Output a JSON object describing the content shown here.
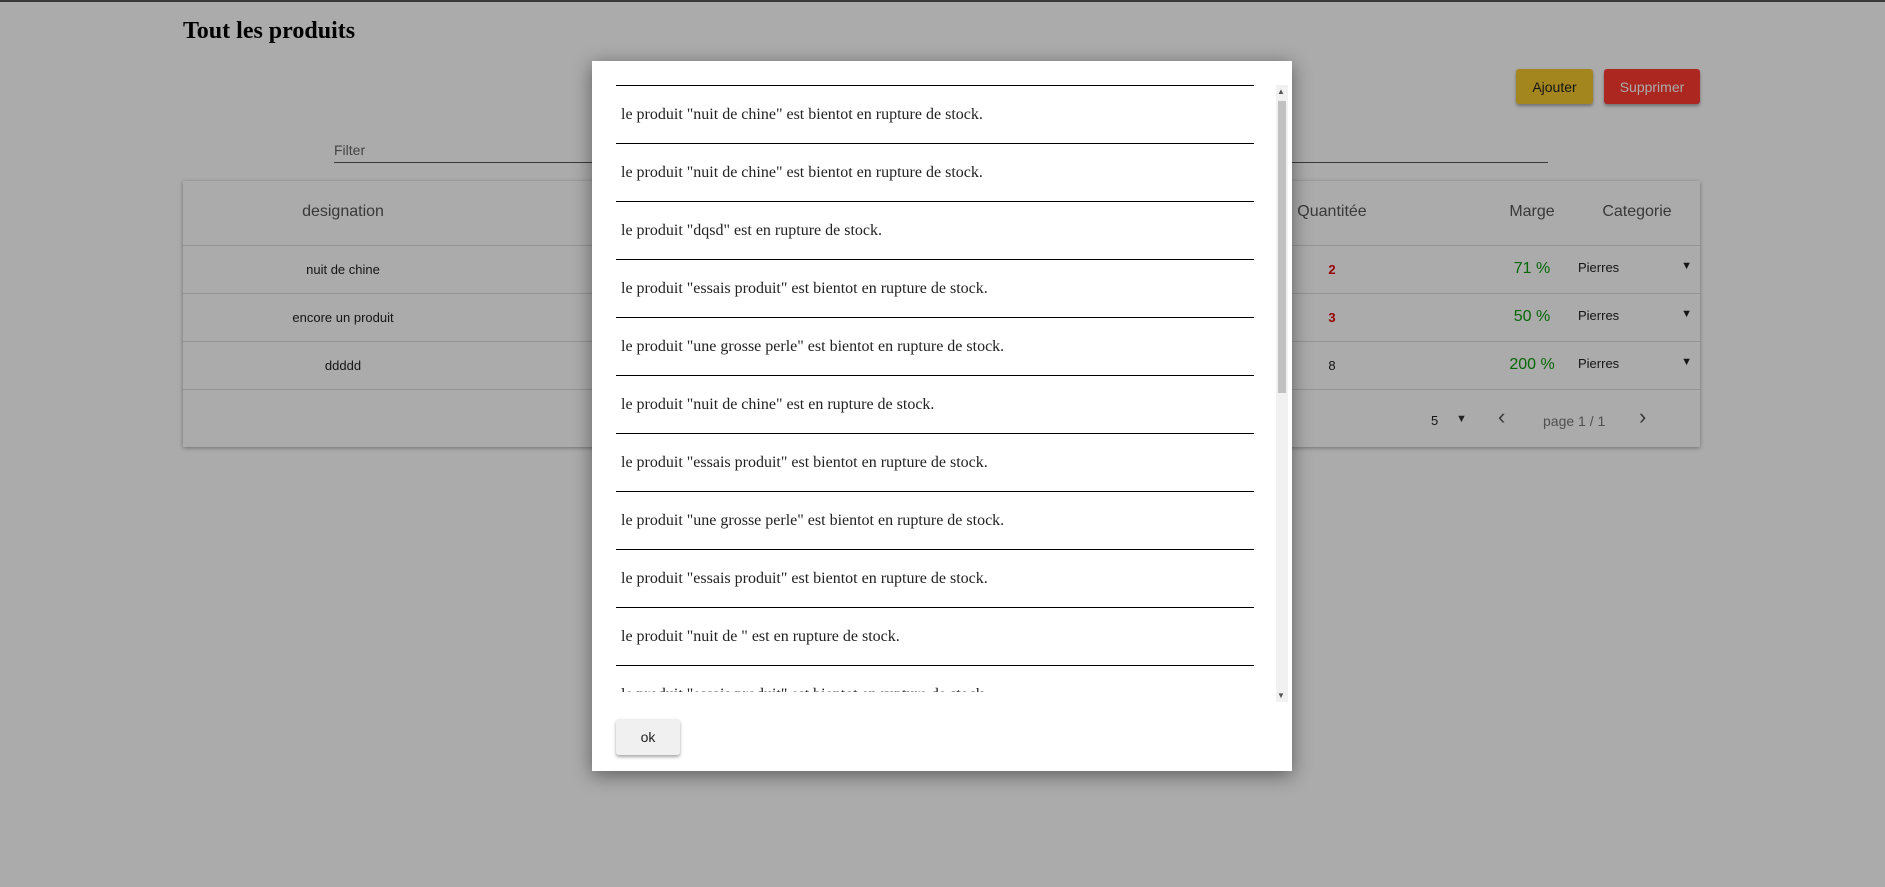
{
  "page": {
    "title": "Tout les produits"
  },
  "toolbar": {
    "add_label": "Ajouter",
    "delete_label": "Supprimer"
  },
  "filter": {
    "placeholder": "Filter"
  },
  "table": {
    "headers": {
      "designation": "designation",
      "quantity": "Quantitée",
      "margin": "Marge",
      "category": "Categorie"
    },
    "rows": [
      {
        "designation": "nuit de chine",
        "quantity": "2",
        "margin": "71 %",
        "category": "Pierres"
      },
      {
        "designation": "encore un produit",
        "quantity": "3",
        "margin": "50 %",
        "category": "Pierres"
      },
      {
        "designation": "ddddd",
        "quantity": "8",
        "margin": "200 %",
        "category": "Pierres"
      }
    ],
    "pagination": {
      "page_size": "5",
      "label": "page 1 / 1"
    }
  },
  "modal": {
    "messages": [
      "le produit \"nuit de chine\" est bientot en rupture de stock.",
      "le produit \"nuit de chine\" est bientot en rupture de stock.",
      "le produit \"dqsd\" est en rupture de stock.",
      "le produit \"essais produit\" est bientot en rupture de stock.",
      "le produit \"une grosse perle\" est bientot en rupture de stock.",
      "le produit \"nuit de chine\" est en rupture de stock.",
      "le produit \"essais produit\" est bientot en rupture de stock.",
      "le produit \"une grosse perle\" est bientot en rupture de stock.",
      "le produit \"essais produit\" est bientot en rupture de stock.",
      "le produit \"nuit de \" est en rupture de stock.",
      "le produit \"essais produit\" est bientot en rupture de stock."
    ],
    "ok_label": "ok"
  },
  "colors": {
    "add_button": "#f5c82e",
    "delete_button": "#ff3b30",
    "low_stock": "#e00000",
    "margin": "#0a9a0a"
  },
  "icons": {
    "prev": "chevron-left-icon",
    "next": "chevron-right-icon",
    "dropdown": "caret-down-icon"
  }
}
